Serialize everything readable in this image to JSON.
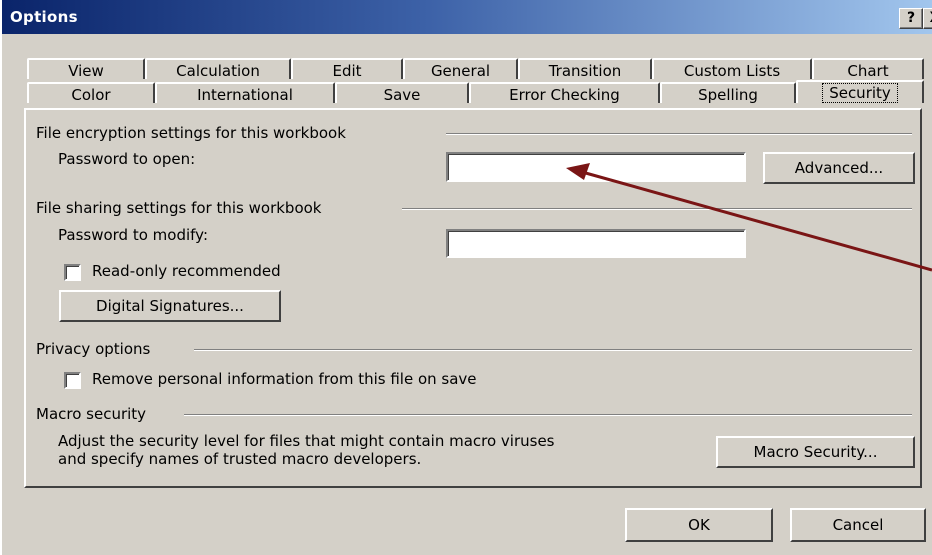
{
  "window": {
    "title": "Options",
    "help_glyph": "?",
    "close_glyph": "X"
  },
  "tabs": {
    "row1": [
      "View",
      "Calculation",
      "Edit",
      "General",
      "Transition",
      "Custom Lists",
      "Chart"
    ],
    "row2": [
      "Color",
      "International",
      "Save",
      "Error Checking",
      "Spelling",
      "Security"
    ],
    "selected": "Security"
  },
  "encryption": {
    "group_label": "File encryption settings for this workbook",
    "password_open_label": "Password to open:",
    "password_open_value": "",
    "advanced_button": "Advanced..."
  },
  "sharing": {
    "group_label": "File sharing settings for this workbook",
    "password_modify_label": "Password to modify:",
    "password_modify_value": "",
    "readonly_label": "Read-only recommended",
    "readonly_checked": false,
    "digital_signatures_button": "Digital Signatures..."
  },
  "privacy": {
    "group_label": "Privacy options",
    "remove_info_label": "Remove personal information from this file on save",
    "remove_info_checked": false
  },
  "macro": {
    "group_label": "Macro security",
    "description_line1": "Adjust the security level for files that might contain macro viruses",
    "description_line2": "and specify names of trusted macro developers.",
    "macro_security_button": "Macro Security..."
  },
  "footer": {
    "ok_button": "OK",
    "cancel_button": "Cancel"
  },
  "colors": {
    "dialog_face": "#d4d0c8",
    "title_gradient_start": "#0a246a",
    "title_gradient_end": "#a6caf0",
    "annotation_arrow": "#7a1515"
  },
  "icons": {
    "annotation": "arrow-pointer-icon",
    "help": "question-mark-icon",
    "close": "close-icon",
    "checkbox": "checkbox-icon"
  }
}
